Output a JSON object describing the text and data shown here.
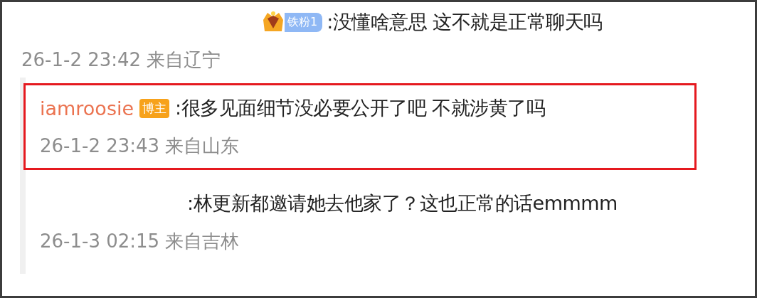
{
  "comment": {
    "fan_badge": "铁粉1",
    "text": ":没懂啥意思 这不就是正常聊天吗",
    "meta": "26-1-2 23:42 来自辽宁"
  },
  "replies": [
    {
      "username": "iamroosie",
      "role_badge": "博主",
      "text": ":很多见面细节没必要公开了吧 不就涉黄了吗",
      "meta": "26-1-2 23:43 来自山东",
      "highlighted": true
    },
    {
      "text": ":林更新都邀请她去他家了？这也正常的话emmmm",
      "meta": "26-1-3 02:15 来自吉林",
      "highlighted": false
    }
  ]
}
